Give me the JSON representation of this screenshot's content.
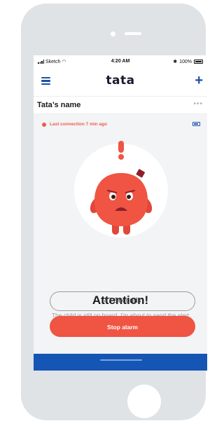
{
  "status_bar": {
    "carrier": "Sketch",
    "time": "4:20 AM",
    "battery_percent": "100%"
  },
  "navbar": {
    "logo": "tata",
    "menu_icon": "hamburger-menu-icon",
    "add_icon": "plus-icon"
  },
  "profile": {
    "name": "Tata’s name",
    "more_label": "•••"
  },
  "connection": {
    "text": "Last connection 7 min ago",
    "dot_color": "#ee5b4b"
  },
  "alert": {
    "heading": "Attention!",
    "message": "The child is still on board. I'm about to send the alert to the emergency contacts in:",
    "countdown": "47 Seconds",
    "stop_label": "Stop alarm"
  },
  "colors": {
    "accent_blue": "#1d4fa8",
    "alert_red": "#f05443",
    "bottom_bar": "#1555b4"
  }
}
